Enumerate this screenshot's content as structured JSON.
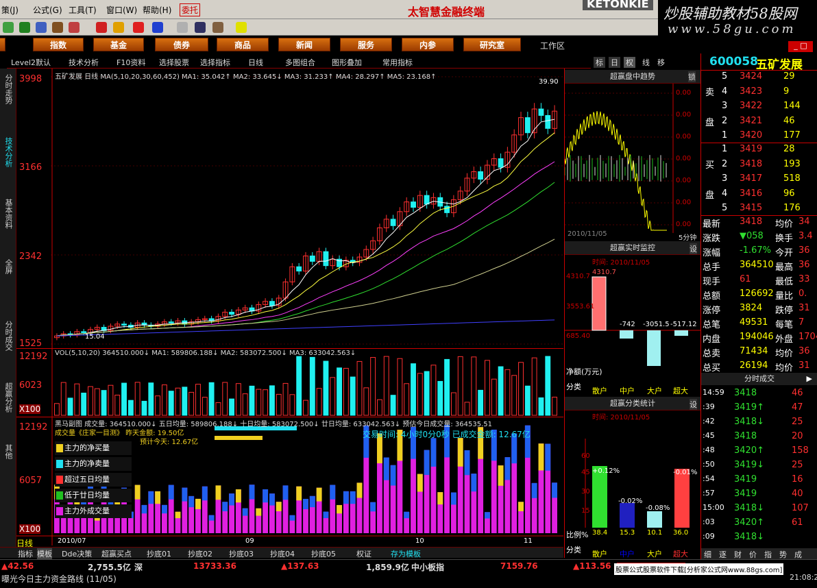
{
  "menu": {
    "items": [
      "策(J)",
      "公式(G)",
      "工具(T)",
      "窗口(W)",
      "帮助(H)",
      "委托"
    ],
    "app_title": "太智慧金融终端",
    "right_text": "KETONKIE"
  },
  "watermark": {
    "line1": "炒股辅助教材58股网",
    "line2": "www.58gu.com"
  },
  "nav": {
    "items": [
      "指数",
      "基金",
      "债券",
      "商品",
      "新闻",
      "服务",
      "内参",
      "研究室"
    ],
    "workspace": "工作区"
  },
  "subtool": {
    "items": [
      "Level2默认",
      "技术分析",
      "F10资料",
      "选择股票",
      "选择指标",
      "日线",
      "多图组合",
      "图形叠加",
      "常用指标"
    ],
    "right_tabs": [
      "标",
      "日",
      "权",
      "线",
      "移"
    ]
  },
  "left_tabs": [
    "分时走势",
    "技术分析",
    "基本资料",
    "全屏",
    "分时成交",
    "超赢分析",
    "其他"
  ],
  "main": {
    "price_header": "五矿发展 日线 MA(5,10,20,30,60,452) MA1: 35.042↑ MA2: 33.645↓ MA3: 31.233↑ MA4: 28.297↑ MA5: 23.168↑",
    "price_labels": [
      "3998",
      "3166",
      "2342",
      "1525"
    ],
    "high_label": "39.90",
    "low_label": "15.04",
    "vol_header": "VOL(5,10,20) 364510.000↓ MA1: 589806.188↓ MA2: 583072.500↓ MA3: 633042.563↓",
    "vol_labels": [
      "12192",
      "6023",
      "X100"
    ],
    "deep_header": "黑马副图 成交量: 364510.000↓ 五日均量: 589806.188↓ 十日均量: 583072.500↓ 廿日均量: 633042.563↓ 预估今日成交量: 364535.51",
    "deep_sub": "成交量《庄家一目测》 昨天金额: 19.50亿",
    "deep_sub2": "预计今天: 12.67亿",
    "trade_time": "交易时间: 4小时0分0秒 已成交金额: 12.67亿",
    "deep_labels": [
      "12192",
      "6057",
      "X100"
    ],
    "legend": [
      "主力的净买量",
      "主力的净卖量",
      "超过五日均量",
      "低于廿日均量",
      "主力外成交量"
    ],
    "legend_colors": [
      "#f0d020",
      "#20e0f0",
      "#ff3030",
      "#20c020",
      "#e020e0"
    ],
    "dates": [
      "2010/07",
      "09",
      "10",
      "11"
    ],
    "daily_label": "日线"
  },
  "bottom_tabs": [
    "指标",
    "模板",
    "Dde决策",
    "超赢买点",
    "抄底01",
    "抄底02",
    "抄底03",
    "抄底04",
    "抄底05",
    "权证",
    "存为模板"
  ],
  "mid": {
    "panel1_title": "超赢盘中趋势",
    "panel1_btn": "锁",
    "panel1_scale": [
      "0.00",
      "0.00",
      "0.00",
      "0.00",
      "0.00",
      "0.00",
      "0.00"
    ],
    "panel1_foot": "2010/11/05",
    "panel1_unit": "5分钟",
    "panel2_title": "超赢实时监控",
    "panel2_btn": "设",
    "panel2_time": "时间: 2010/11/05",
    "panel2_scale": [
      "4310.7",
      "3553.61",
      "685.40"
    ],
    "panel2_vals": [
      "4310.7",
      "-742",
      "-3051.5",
      "-517.12"
    ],
    "panel2_ylabel": "净额(万元)",
    "panel2_xlabel": "分类",
    "panel2_cats": [
      "散户",
      "中户",
      "大户",
      "超大"
    ],
    "panel3_title": "超赢分类统计",
    "panel3_btn": "设",
    "panel3_time": "时间: 2010/11/05",
    "panel3_scale": [
      "60",
      "45",
      "30",
      "15"
    ],
    "panel3_pcts": [
      "+0.12%",
      "-0.02%",
      "-0.08%",
      "-0.01%"
    ],
    "panel3_vals": [
      "38.4",
      "15.3",
      "10.1",
      "36.0"
    ],
    "panel3_ylabel": "比例%",
    "panel3_xlabel": "分类"
  },
  "right": {
    "code": "600058",
    "name": "五矿发展",
    "sell_label": [
      "卖",
      "盘"
    ],
    "buy_label": [
      "买",
      "盘"
    ],
    "asks": [
      [
        "5",
        "3424",
        "29"
      ],
      [
        "4",
        "3423",
        "9"
      ],
      [
        "3",
        "3422",
        "144"
      ],
      [
        "2",
        "3421",
        "46"
      ],
      [
        "1",
        "3420",
        "177"
      ]
    ],
    "bids": [
      [
        "1",
        "3419",
        "28"
      ],
      [
        "2",
        "3418",
        "193"
      ],
      [
        "3",
        "3417",
        "518"
      ],
      [
        "4",
        "3416",
        "96"
      ],
      [
        "5",
        "3415",
        "176"
      ]
    ],
    "stats": [
      [
        "最新",
        "3418",
        "均价",
        "34"
      ],
      [
        "涨跌",
        "▼058",
        "换手",
        "3.4"
      ],
      [
        "涨幅",
        "-1.67%",
        "今开",
        "36"
      ],
      [
        "总手",
        "364510",
        "最高",
        "36"
      ],
      [
        "现手",
        "61",
        "最低",
        "33"
      ],
      [
        "总额",
        "126692",
        "量比",
        "0."
      ],
      [
        "涨停",
        "3824",
        "跌停",
        "31"
      ],
      [
        "总笔",
        "49531",
        "每笔",
        "7"
      ],
      [
        "内盘",
        "194046",
        "外盘",
        "1704"
      ],
      [
        "总卖",
        "71434",
        "均价",
        "36"
      ],
      [
        "总买",
        "26194",
        "均价",
        "31"
      ]
    ],
    "ticks_title": "分时成交",
    "ticks": [
      [
        "14:59",
        "3418",
        "46"
      ],
      [
        ":39",
        "3419↑",
        "47"
      ],
      [
        ":42",
        "3418↓",
        "25"
      ],
      [
        ":45",
        "3418",
        "20"
      ],
      [
        ":48",
        "3420↑",
        "158"
      ],
      [
        ":50",
        "3419↓",
        "25"
      ],
      [
        ":54",
        "3419",
        "16"
      ],
      [
        ":57",
        "3419",
        "40"
      ],
      [
        "15:00",
        "3418↓",
        "107"
      ],
      [
        ":03",
        "3420↑",
        "61"
      ],
      [
        ":09",
        "3418↓",
        ""
      ]
    ],
    "bottom_tabs": [
      "细",
      "逐",
      "财",
      "价",
      "指",
      "势",
      "成"
    ]
  },
  "status1": {
    "items": [
      "▲42.56",
      "2,755.5亿",
      "深",
      "13733.36",
      "▲137.63",
      "1,859.9亿",
      "中小板指",
      "7159.76",
      "▲113.56"
    ]
  },
  "status2": {
    "ticker": "曝光今日主力资金路线 (11/05)",
    "ad": "股票公式股票软件下载[分析家公式网www.88gs.com]",
    "time": "21:08:2"
  },
  "colors": {
    "up": "#ff3030",
    "down": "#20f0f0",
    "ma1": "#ffffff",
    "ma2": "#ffff40",
    "ma3": "#ff40ff",
    "ma4": "#30e030",
    "ma5": "#d0d090",
    "ma6": "#4040ff",
    "accent": "#c80000"
  },
  "chart_data": {
    "type": "candlestick",
    "title": "五矿发展 日线",
    "price_axis": [
      15.25,
      39.98
    ],
    "candles_close": [
      16.0,
      16.2,
      16.1,
      16.4,
      16.3,
      16.6,
      16.8,
      16.5,
      16.9,
      17.1,
      17.0,
      16.8,
      17.2,
      17.0,
      16.9,
      17.1,
      17.3,
      17.2,
      17.4,
      17.1,
      17.3,
      17.5,
      17.6,
      17.4,
      17.8,
      18.2,
      18.0,
      18.4,
      18.6,
      18.3,
      18.9,
      19.2,
      18.8,
      19.5,
      21.0,
      22.4,
      22.0,
      23.4,
      22.9,
      23.8,
      22.5,
      23.1,
      22.4,
      23.0,
      22.8,
      23.3,
      24.0,
      24.8,
      26.0,
      26.8,
      26.2,
      27.5,
      28.4,
      27.9,
      29.0,
      28.2,
      28.8,
      28.0,
      27.4,
      28.6,
      29.4,
      30.6,
      31.2,
      30.5,
      31.8,
      32.4,
      31.6,
      33.0,
      34.6,
      36.2,
      34.8,
      37.0,
      36.4,
      35.2,
      36.8
    ]
  }
}
